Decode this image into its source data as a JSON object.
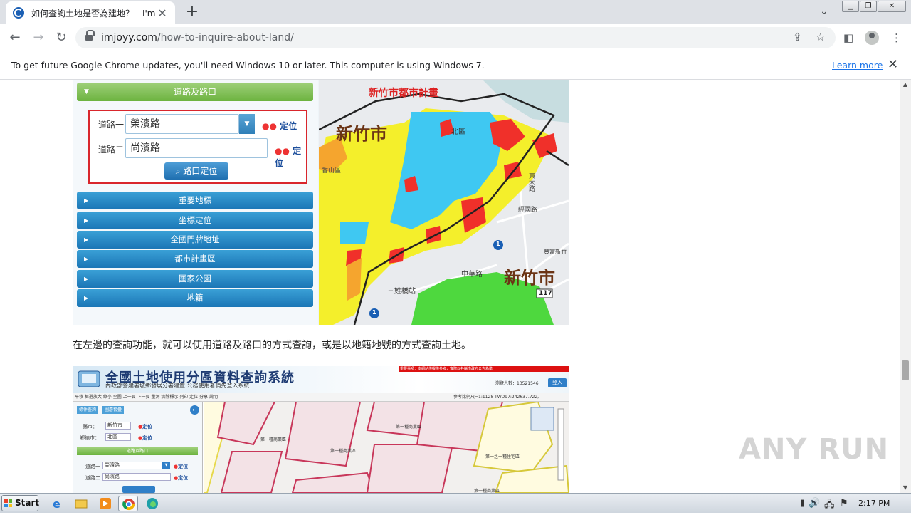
{
  "browser": {
    "tab": {
      "title": "如何查詢土地是否為建地？ - I'm Joy"
    },
    "url": {
      "domain": "imjoyy.com",
      "path": "/how-to-inquire-about-land/"
    },
    "infobar": {
      "message": "To get future Google Chrome updates, you'll need Windows 10 or later. This computer is using Windows 7.",
      "link": "Learn more"
    }
  },
  "article": {
    "figure1": {
      "panel_header": "道路及路口",
      "road1_label": "道路一",
      "road1_value": "榮濱路",
      "road2_label": "道路二",
      "road2_value": "尚濱路",
      "locate_label": "定位",
      "intersection_button": "路口定位",
      "menu_items": [
        "重要地標",
        "坐標定位",
        "全國門牌地址",
        "都市計畫區",
        "國家公園",
        "地籍"
      ],
      "map_labels": {
        "plan_title": "新竹市都市計畫",
        "city_big_1": "新竹市",
        "city_big_2": "新竹市",
        "north_district": "北區",
        "xiangshan": "香山區",
        "east_street": "東大路",
        "jinguo": "經國路",
        "zhonghua": "中華路",
        "sanxing": "三姓橋站",
        "route1a": "1",
        "route1b": "1",
        "route117": "117",
        "fengyuan": "豐富新竹"
      }
    },
    "caption": "在左邊的查詢功能，就可以使用道路及路口的方式查詢，或是以地籍地號的方式查詢土地。",
    "figure2": {
      "banner_title": "全國土地使用分區資料查詢系統",
      "banner_subtitle": "內政部營建署城鄉發展分署建置 公務使用者請先登入系統",
      "banner_notice": "重要事項：本網站僅提供參考，實際以各縣市政府公告為準",
      "visitor_count": "瀏覽人數：13521546",
      "login_button": "登入",
      "toolbar_text": "平移  框選放大  縮小  全圖  上一頁  下一頁  量測  清除標示  列印  定位  分享  說明",
      "coords_text": "參考比例尺=1:1128   TWD97:242637.722, 2748225.461",
      "tabs": [
        "條件查詢",
        "圖層套疊"
      ],
      "county_label": "縣市：",
      "county_value": "新竹市",
      "district_label": "鄉鎮市：",
      "district_value": "北區",
      "section_header": "道路及路口",
      "road1_label": "道路一",
      "road1_value": "榮濱路",
      "road2_label": "道路二",
      "road2_value": "尚濱路",
      "locate_label": "定位",
      "zone_labels": [
        "第一種商業區",
        "第一種商業區",
        "第一之一種住宅區",
        "第一種商業區",
        "第一種商業區"
      ]
    }
  },
  "watermark": "ANY RUN",
  "taskbar": {
    "start_label": "Start",
    "clock": "2:17 PM"
  }
}
